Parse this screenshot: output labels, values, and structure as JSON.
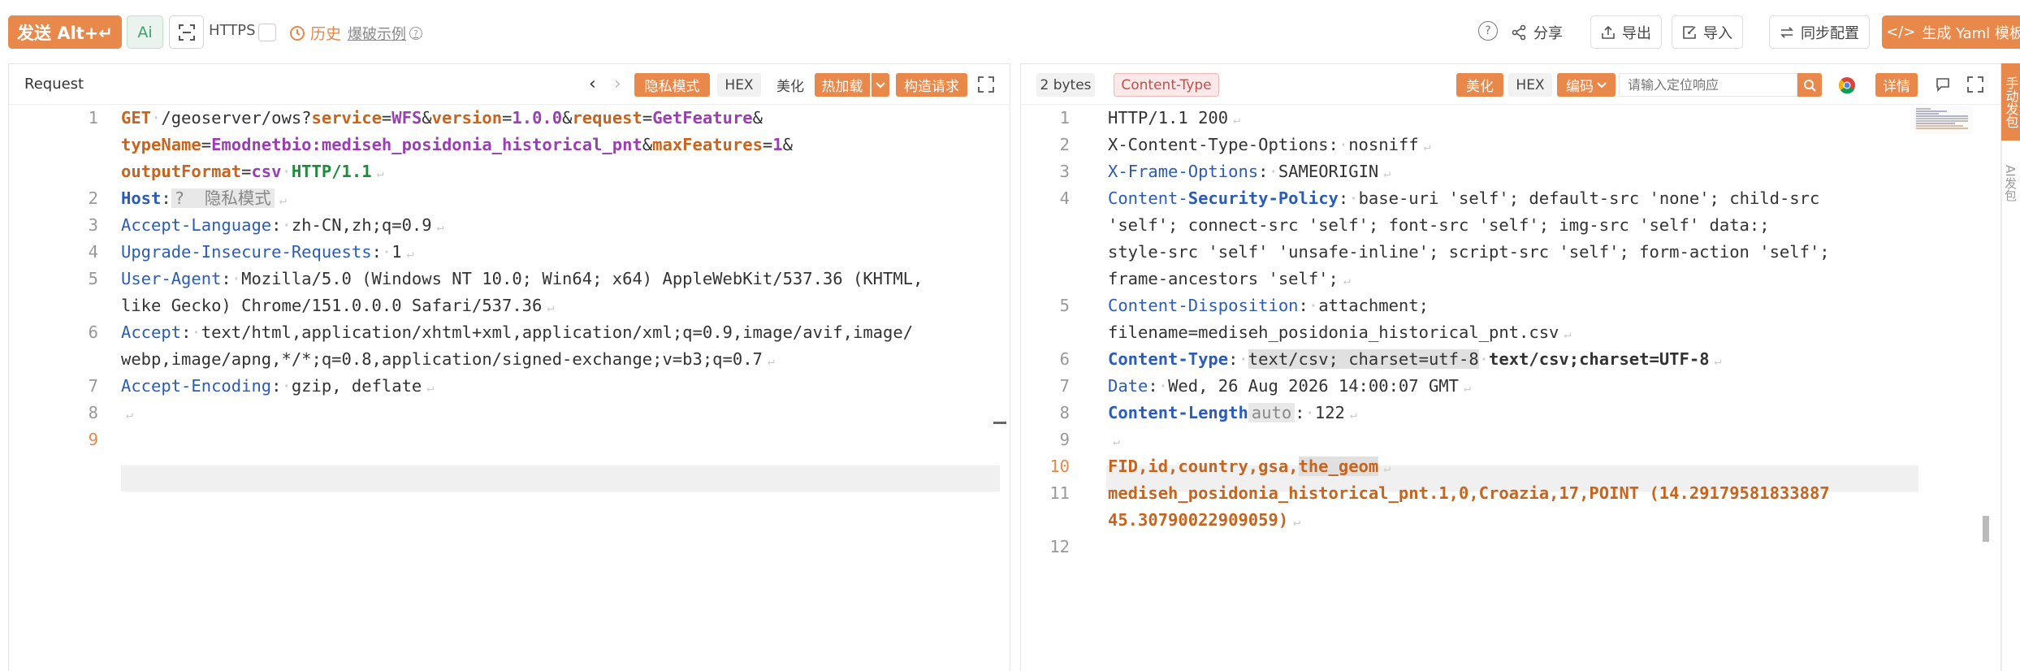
{
  "toolbar": {
    "send_label": "发送 Alt+↵",
    "ai_label": "Ai",
    "https_label": "HTTPS",
    "history_label": "历史",
    "example_label": "爆破示例",
    "share_label": "分享",
    "export_label": "导出",
    "import_label": "导入",
    "sync_label": "同步配置",
    "yaml_label": "生成 Yaml 模板"
  },
  "request": {
    "title": "Request",
    "stealth_label": "隐私模式",
    "hex_label": "HEX",
    "beautify_label": "美化",
    "hotload_label": "热加载",
    "build_label": "构造请求",
    "lines": {
      "l1_method": "GET",
      "l1_path": "/geoserver/ows?",
      "p_service": "service",
      "v_service": "WFS",
      "p_version": "version",
      "v_version": "1.0.0",
      "p_request": "request",
      "v_request": "GetFeature",
      "p_typename": "typeName",
      "v_typename": "Emodnetbio:mediseh_posidonia_historical_pnt",
      "p_maxfeatures": "maxFeatures",
      "v_maxfeatures": "1",
      "p_format": "outputFormat",
      "v_format": "csv",
      "http_ver": "HTTP/1.1",
      "host_key": "Host",
      "host_ghost": "?  隐私模式",
      "al_key": "Accept-Language",
      "al_val": "zh-CN,zh;q=0.9",
      "uir_key": "Upgrade-Insecure-Requests",
      "uir_val": "1",
      "ua_key": "User-Agent",
      "ua_val1": "Mozilla/5.0 (Windows NT 10.0; Win64; x64) AppleWebKit/537.36 (KHTML,",
      "ua_val2": "like Gecko) Chrome/151.0.0.0 Safari/537.36",
      "acc_key": "Accept",
      "acc_val1": "text/html,application/xhtml+xml,application/xml;q=0.9,image/avif,image/",
      "acc_val2": "webp,image/apng,*/*;q=0.8,application/signed-exchange;v=b3;q=0.7",
      "ae_key": "Accept-Encoding",
      "ae_val": "gzip, deflate"
    },
    "line_numbers": [
      "1",
      "2",
      "3",
      "4",
      "5",
      "6",
      "7",
      "8",
      "9"
    ]
  },
  "response": {
    "size_label": "2 bytes",
    "ctype_label": "Content-Type",
    "beautify_label": "美化",
    "hex_label": "HEX",
    "encoding_label": "编码",
    "search_placeholder": "请输入定位响应",
    "detail_label": "详情",
    "lines": {
      "status": "HTTP/1.1 200",
      "xcto_key": "X-Content-Type-Options",
      "xcto_val": "nosniff",
      "xfo_key": "X-Frame-Options",
      "xfo_val": "SAMEORIGIN",
      "csp_key_a": "Content-",
      "csp_key_b": "Security-Policy",
      "csp_val1": "base-uri 'self'; default-src 'none'; child-src",
      "csp_val2": "'self'; connect-src 'self'; font-src 'self'; img-src 'self' data:;",
      "csp_val3": "style-src 'self' 'unsafe-inline'; script-src 'self'; form-action 'self';",
      "csp_val4": "frame-ancestors 'self';",
      "cd_key": "Content-Disposition",
      "cd_val1": "attachment;",
      "cd_val2": "filename=mediseh_posidonia_historical_pnt.csv",
      "ct_key": "Content-Type",
      "ct_val": "text/csv; charset=utf-8",
      "ct_hint": "text/csv;charset=UTF-8",
      "date_key": "Date",
      "date_val": "Wed, 26 Aug 2026 14:00:07 GMT",
      "cl_key": "Content-Length",
      "cl_hint": "auto",
      "cl_val": "122",
      "body1_a": "FID,id,country,gsa,",
      "body1_b": "the_geom",
      "body2a": "mediseh_posidonia_historical_pnt.1,0,Croazia,17,POINT (14.29179581833887",
      "body2b": "45.30790022909059)"
    },
    "line_numbers": [
      "1",
      "2",
      "3",
      "4",
      "5",
      "6",
      "7",
      "8",
      "9",
      "10",
      "11",
      "12"
    ]
  },
  "side": {
    "tab_a": "手动发包",
    "tab_b": "AI发包"
  },
  "colors": {
    "accent": "#e8884a",
    "header_key": "#2b5cb8",
    "param": "#c7641e",
    "value": "#9a3fb3",
    "version": "#1e8a3c"
  }
}
